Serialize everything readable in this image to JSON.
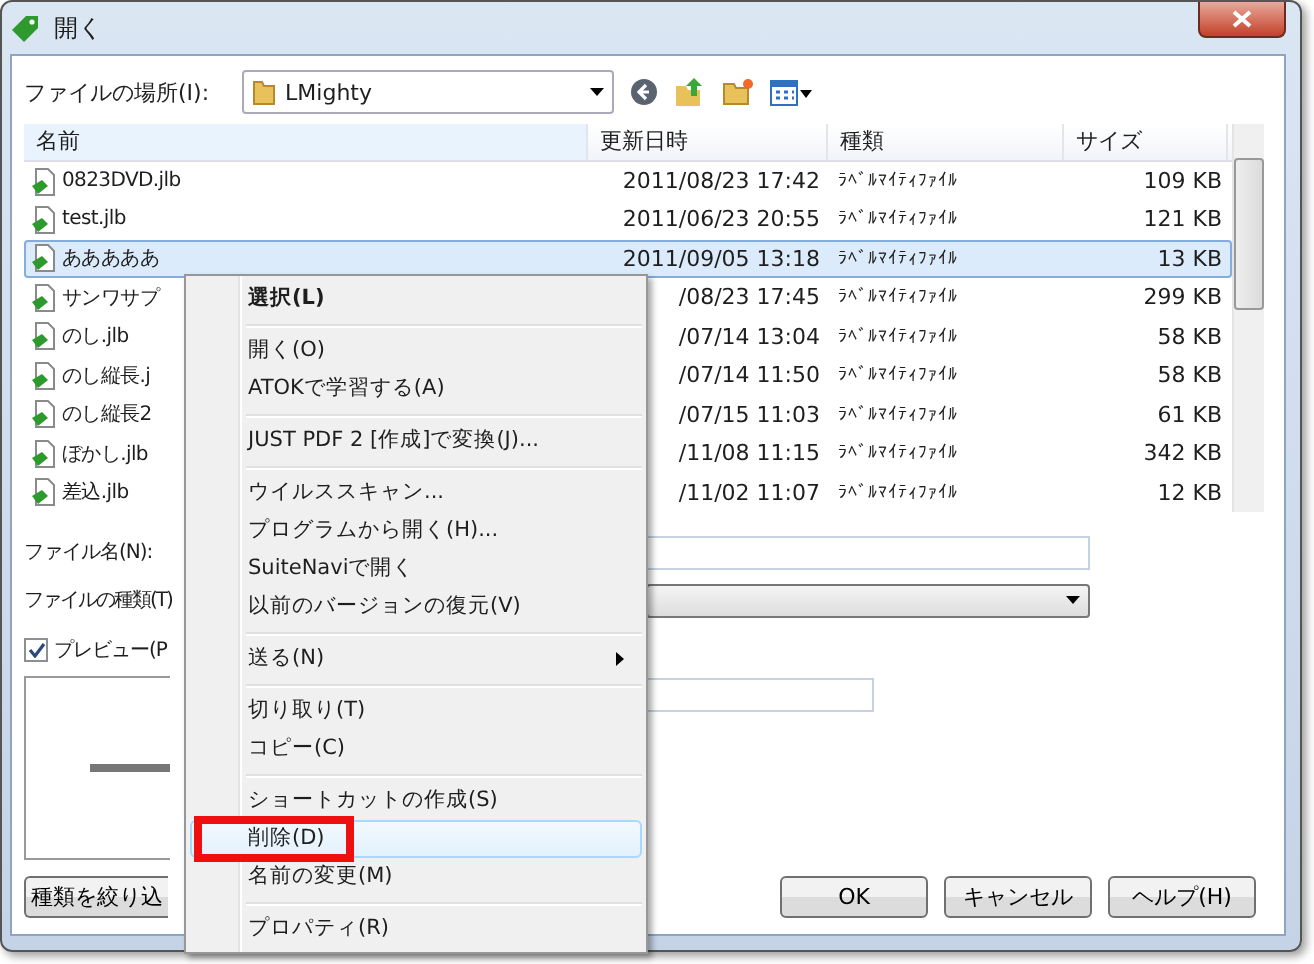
{
  "window": {
    "title": "開く"
  },
  "location": {
    "label": "ファイルの場所(I):",
    "value": "LMighty"
  },
  "columns": [
    "名前",
    "更新日時",
    "種類",
    "サイズ"
  ],
  "rows": [
    {
      "name": "0823DVD.jlb",
      "modified": "2011/08/23 17:42",
      "type": "ﾗﾍﾞﾙﾏｲﾃｨﾌｧｲﾙ",
      "size": "109 KB",
      "selected": false
    },
    {
      "name": "test.jlb",
      "modified": "2011/06/23 20:55",
      "type": "ﾗﾍﾞﾙﾏｲﾃｨﾌｧｲﾙ",
      "size": "121 KB",
      "selected": false
    },
    {
      "name": "あああああ",
      "modified": "2011/09/05 13:18",
      "type": "ﾗﾍﾞﾙﾏｲﾃｨﾌｧｲﾙ",
      "size": "13 KB",
      "selected": true
    },
    {
      "name": "サンワサプ",
      "modified": "/08/23 17:45",
      "type": "ﾗﾍﾞﾙﾏｲﾃｨﾌｧｲﾙ",
      "size": "299 KB",
      "selected": false
    },
    {
      "name": "のし.jlb",
      "modified": "/07/14 13:04",
      "type": "ﾗﾍﾞﾙﾏｲﾃｨﾌｧｲﾙ",
      "size": "58 KB",
      "selected": false
    },
    {
      "name": "のし縦長.j",
      "modified": "/07/14 11:50",
      "type": "ﾗﾍﾞﾙﾏｲﾃｨﾌｧｲﾙ",
      "size": "58 KB",
      "selected": false
    },
    {
      "name": "のし縦長2",
      "modified": "/07/15 11:03",
      "type": "ﾗﾍﾞﾙﾏｲﾃｨﾌｧｲﾙ",
      "size": "61 KB",
      "selected": false
    },
    {
      "name": "ぼかし.jlb",
      "modified": "/11/08 11:15",
      "type": "ﾗﾍﾞﾙﾏｲﾃｨﾌｧｲﾙ",
      "size": "342 KB",
      "selected": false
    },
    {
      "name": "差込.jlb",
      "modified": "/11/02 11:07",
      "type": "ﾗﾍﾞﾙﾏｲﾃｨﾌｧｲﾙ",
      "size": "12 KB",
      "selected": false
    }
  ],
  "file_name": {
    "label": "ファイル名(N):"
  },
  "file_type": {
    "label": "ファイルの種類(T)"
  },
  "preview": {
    "label": "プレビュー(P",
    "checked": true
  },
  "filter_button": "種類を絞り込",
  "buttons": [
    "OK",
    "キャンセル",
    "ヘルプ(H)"
  ],
  "context_menu": [
    {
      "kind": "item",
      "label": "選択(L)",
      "bold": true
    },
    {
      "kind": "separator"
    },
    {
      "kind": "item",
      "label": "開く(O)"
    },
    {
      "kind": "item",
      "label": "ATOKで学習する(A)"
    },
    {
      "kind": "separator"
    },
    {
      "kind": "item",
      "label": "JUST PDF 2 [作成]で変換(J)..."
    },
    {
      "kind": "separator"
    },
    {
      "kind": "item",
      "label": "ウイルススキャン..."
    },
    {
      "kind": "item",
      "label": "プログラムから開く(H)..."
    },
    {
      "kind": "item",
      "label": "SuiteNaviで開く"
    },
    {
      "kind": "item",
      "label": "以前のバージョンの復元(V)"
    },
    {
      "kind": "separator"
    },
    {
      "kind": "item",
      "label": "送る(N)",
      "submenu": true
    },
    {
      "kind": "separator"
    },
    {
      "kind": "item",
      "label": "切り取り(T)"
    },
    {
      "kind": "item",
      "label": "コピー(C)"
    },
    {
      "kind": "separator"
    },
    {
      "kind": "item",
      "label": "ショートカットの作成(S)"
    },
    {
      "kind": "item",
      "label": "削除(D)",
      "highlighted": true,
      "marked": true
    },
    {
      "kind": "item",
      "label": "名前の変更(M)"
    },
    {
      "kind": "separator"
    },
    {
      "kind": "item",
      "label": "プロパティ(R)"
    }
  ]
}
